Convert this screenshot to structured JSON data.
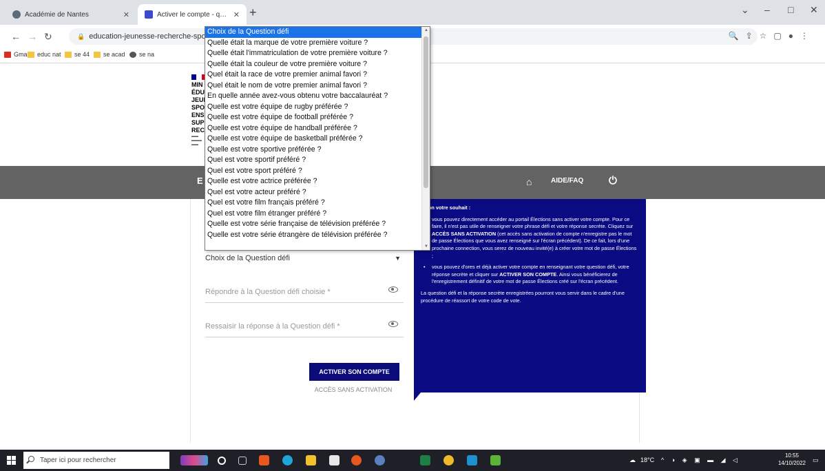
{
  "browser": {
    "tabs": [
      {
        "title": "Académie de Nantes",
        "favicon_color": "#5a6a7a"
      },
      {
        "title": "Activer le compte - question dé",
        "favicon_color": "#3b4bd0"
      }
    ],
    "url": "education-jeunesse-recherche-sports",
    "bookmarks": [
      {
        "label": "Gmail",
        "color": "#d93025"
      },
      {
        "label": "educ nat",
        "color": "#f4c542"
      },
      {
        "label": "se 44",
        "color": "#f4c542"
      },
      {
        "label": "se acad",
        "color": "#f4c542"
      },
      {
        "label": "se na",
        "color": "#555555"
      }
    ]
  },
  "logo": {
    "lines": [
      "MIN",
      "ÉDU",
      "JEUN",
      "SPO",
      "ENS",
      "SUP",
      "REC"
    ]
  },
  "header_band": {
    "left_text": "E",
    "aide_label": "AIDE/FAQ"
  },
  "form": {
    "select_value": "Choix de la Question défi",
    "answer_placeholder": "Répondre à la Question défi choisie *",
    "confirm_placeholder": "Ressaisir la réponse à la Question défi *",
    "activate_button": "ACTIVER SON COMPTE",
    "no_activation_link": "ACCÈS SANS ACTIVATION"
  },
  "info": {
    "heading": "Selon votre souhait :",
    "bullet1_a": "vous pouvez directement accéder au portail Élections sans activer votre compte. Pour ce faire, il n'est pas utile de renseigner votre phrase défi et votre réponse secrète. Cliquez sur ",
    "bullet1_b": "ACCÈS SANS ACTIVATION",
    "bullet1_c": " (cet accès sans activation de compte n'enregistre pas le mot de passe Élections que vous avez renseigné sur l'écran précédent). De ce fait, lors d'une prochaine connection, vous serez de nouveau invité(e) à créer votre mot de passe Élections ;",
    "bullet2_a": "vous pouvez d'ores et déjà activer votre compte en renseignant votre question défi, votre réponse secrète et cliquer sur ",
    "bullet2_b": "ACTIVER SON COMPTE",
    "bullet2_c": ". Ainsi vous bénéficierez de l'enregistrement définitif de votre mot de passe Élections créé sur l'écran précédent.",
    "footer": "La question défi et la réponse secrète enregistrées pourront vous servir dans le cadre d'une procédure de réassort de votre code de vote."
  },
  "dropdown": {
    "options": [
      "Choix de la Question défi",
      "Quelle était la marque de votre première voiture ?",
      "Quelle était l'immatriculation de votre première voiture ?",
      "Quelle était la couleur de votre première voiture ?",
      "Quel était la race de votre premier animal favori ?",
      "Quel était le nom de votre premier animal favori ?",
      "En quelle année avez-vous obtenu votre baccalauréat ?",
      "Quelle est votre équipe de rugby préférée ?",
      "Quelle est votre équipe de football préférée ?",
      "Quelle est votre équipe de handball préférée ?",
      "Quelle est votre équipe de basketball préférée ?",
      "Quelle est votre sportive préférée ?",
      "Quel est votre sportif préféré ?",
      "Quel est votre sport préféré ?",
      "Quelle est votre actrice préférée ?",
      "Quel est votre acteur préféré ?",
      "Quel est votre film français préféré ?",
      "Quel est votre film étranger préféré ?",
      "Quelle est votre série française de télévision préférée ?",
      "Quelle est votre série étrangère de télévision préférée ?"
    ],
    "selected_index": 0
  },
  "taskbar": {
    "search_placeholder": "Taper ici pour rechercher",
    "weather": "18°C",
    "time": "10:55",
    "date": "14/10/2022"
  },
  "colors": {
    "navy": "#0a0a82",
    "band": "#636363",
    "highlight": "#1a73e8"
  }
}
